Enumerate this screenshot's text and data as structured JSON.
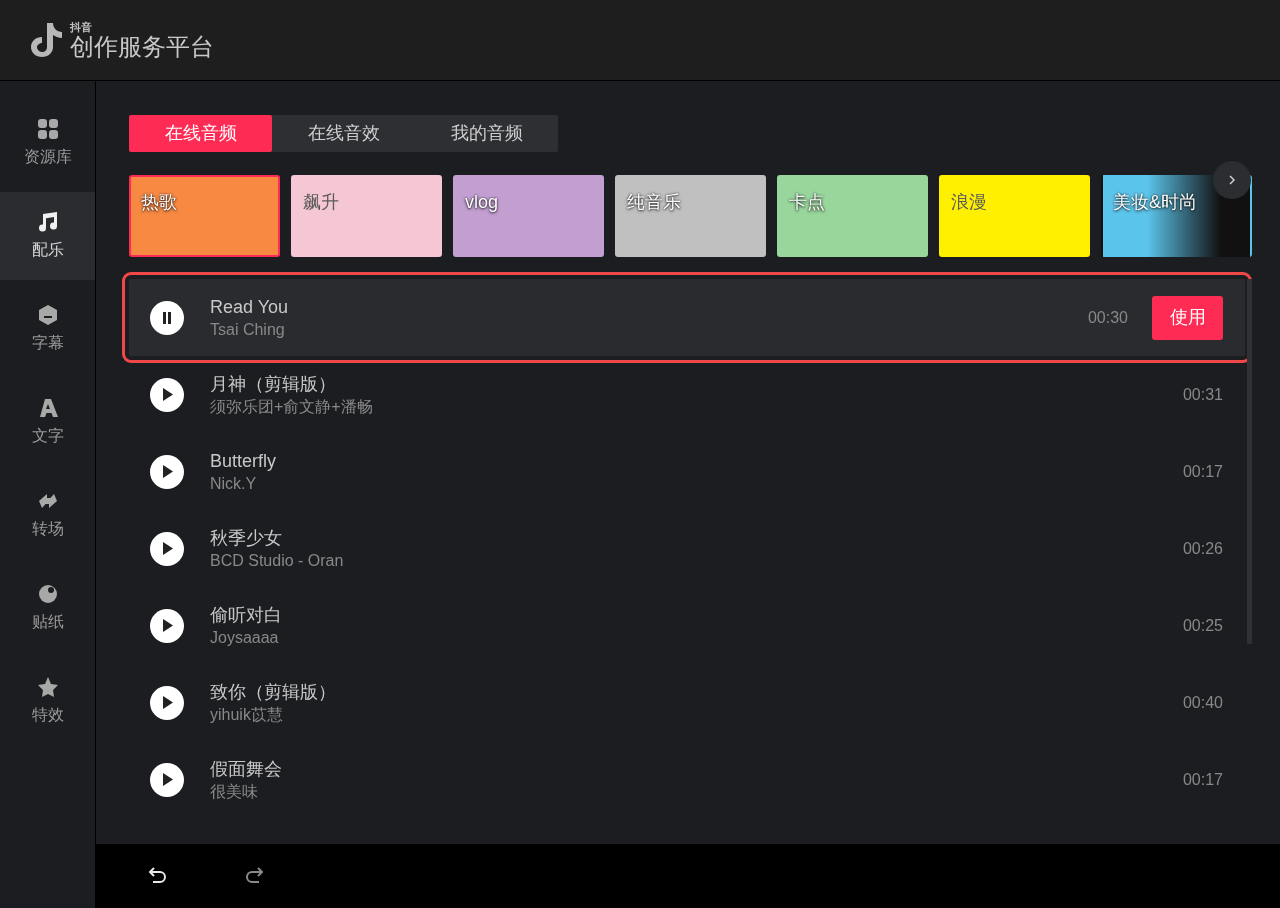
{
  "header": {
    "logo_small": "抖音",
    "logo_title": "创作服务平台"
  },
  "sidebar": {
    "items": [
      {
        "label": "资源库",
        "selected": false
      },
      {
        "label": "配乐",
        "selected": true
      },
      {
        "label": "字幕",
        "selected": false
      },
      {
        "label": "文字",
        "selected": false
      },
      {
        "label": "转场",
        "selected": false
      },
      {
        "label": "贴纸",
        "selected": false
      },
      {
        "label": "特效",
        "selected": false
      }
    ]
  },
  "tabs": [
    {
      "label": "在线音频",
      "selected": true
    },
    {
      "label": "在线音效",
      "selected": false
    },
    {
      "label": "我的音频",
      "selected": false
    }
  ],
  "categories": [
    {
      "label": "热歌",
      "color": "#f78943",
      "selected": true
    },
    {
      "label": "飙升",
      "color": "#f5c6d4",
      "selected": false
    },
    {
      "label": "vlog",
      "color": "#c29ed1",
      "selected": false
    },
    {
      "label": "纯音乐",
      "color": "#c0c0c0",
      "selected": false
    },
    {
      "label": "卡点",
      "color": "#98d69c",
      "selected": false
    },
    {
      "label": "浪漫",
      "color": "#fff000",
      "selected": false
    },
    {
      "label": "美妆&时尚",
      "color": "#5bc4ea",
      "selected": false
    }
  ],
  "songs": [
    {
      "title": "Read You",
      "artist": "Tsai Ching",
      "duration": "00:30",
      "playing": true,
      "selected": true,
      "action": "使用"
    },
    {
      "title": "月神（剪辑版）",
      "artist": "须弥乐团+俞文静+潘畅",
      "duration": "00:31",
      "playing": false,
      "selected": false
    },
    {
      "title": "Butterfly",
      "artist": "Nick.Y",
      "duration": "00:17",
      "playing": false,
      "selected": false
    },
    {
      "title": "秋季少女",
      "artist": "BCD Studio - Oran",
      "duration": "00:26",
      "playing": false,
      "selected": false
    },
    {
      "title": "偷听对白",
      "artist": "Joysaaaa",
      "duration": "00:25",
      "playing": false,
      "selected": false
    },
    {
      "title": "致你（剪辑版）",
      "artist": "yihuik苡慧",
      "duration": "00:40",
      "playing": false,
      "selected": false
    },
    {
      "title": "假面舞会",
      "artist": "很美味",
      "duration": "00:17",
      "playing": false,
      "selected": false
    }
  ],
  "toolbar": {
    "undo_enabled": true,
    "redo_enabled": false
  }
}
